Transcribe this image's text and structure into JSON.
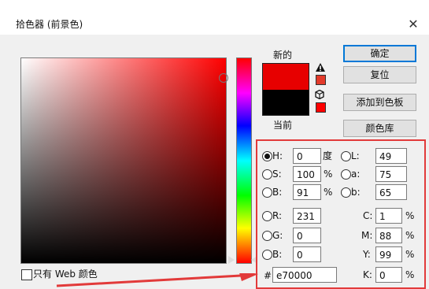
{
  "window": {
    "title": "拾色器 (前景色)",
    "close_glyph": "✕"
  },
  "preview": {
    "new_label": "新的",
    "current_label": "当前",
    "new_color": "#e70000",
    "current_color": "#000000",
    "gamut_warning_color": "#e33a2a",
    "web_safe_color": "#ff0000"
  },
  "buttons": {
    "ok": "确定",
    "reset": "复位",
    "add_to_swatches": "添加到色板",
    "color_libraries": "颜色库"
  },
  "fields": {
    "H": {
      "label": "H:",
      "value": "0",
      "unit": "度"
    },
    "S": {
      "label": "S:",
      "value": "100",
      "unit": "%"
    },
    "B": {
      "label": "B:",
      "value": "91",
      "unit": "%"
    },
    "R": {
      "label": "R:",
      "value": "231"
    },
    "G": {
      "label": "G:",
      "value": "0"
    },
    "Bl": {
      "label": "B:",
      "value": "0"
    },
    "L": {
      "label": "L:",
      "value": "49"
    },
    "a": {
      "label": "a:",
      "value": "75"
    },
    "b": {
      "label": "b:",
      "value": "65"
    },
    "C": {
      "label": "C:",
      "value": "1",
      "unit": "%"
    },
    "M": {
      "label": "M:",
      "value": "88",
      "unit": "%"
    },
    "Y": {
      "label": "Y:",
      "value": "99",
      "unit": "%"
    },
    "K": {
      "label": "K:",
      "value": "0",
      "unit": "%"
    },
    "hex": {
      "label": "#",
      "value": "e70000"
    }
  },
  "web_only": {
    "label": "只有 Web 颜色",
    "checked": false
  },
  "accents": {
    "highlight": "#e23a3a",
    "focus": "#0078d7"
  },
  "icons": {
    "gamut_warning": "warning-triangle-icon",
    "web_safe": "cube-icon",
    "close": "close-icon"
  }
}
